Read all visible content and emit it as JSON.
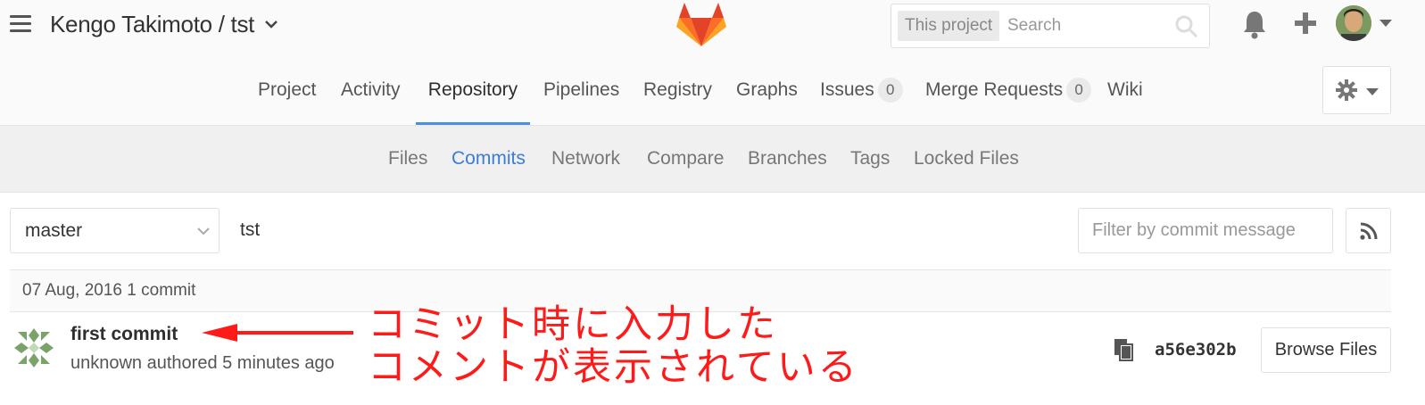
{
  "header": {
    "breadcrumb": "Kengo Takimoto / tst",
    "search_scope": "This project",
    "search_placeholder": "Search"
  },
  "nav": {
    "tabs": [
      {
        "label": "Project"
      },
      {
        "label": "Activity"
      },
      {
        "label": "Repository"
      },
      {
        "label": "Pipelines"
      },
      {
        "label": "Registry"
      },
      {
        "label": "Graphs"
      },
      {
        "label": "Issues",
        "count": "0"
      },
      {
        "label": "Merge Requests",
        "count": "0"
      },
      {
        "label": "Wiki"
      }
    ],
    "active": "Repository"
  },
  "subnav": {
    "tabs": [
      {
        "label": "Files"
      },
      {
        "label": "Commits"
      },
      {
        "label": "Network"
      },
      {
        "label": "Compare"
      },
      {
        "label": "Branches"
      },
      {
        "label": "Tags"
      },
      {
        "label": "Locked Files"
      }
    ],
    "active": "Commits"
  },
  "toolbar": {
    "branch": "master",
    "project_path": "tst",
    "filter_placeholder": "Filter by commit message"
  },
  "commits": {
    "day_header": "07 Aug, 2016 1 commit",
    "items": [
      {
        "title": "first commit",
        "meta": "unknown authored 5 minutes ago",
        "sha": "a56e302b",
        "browse_label": "Browse Files"
      }
    ]
  },
  "annotation": {
    "line1": "コミット時に入力した",
    "line2": "コメントが表示されている",
    "color": "#ff1a1a"
  },
  "colors": {
    "accent": "#4a90e2",
    "subnav_active": "#3a7dd8",
    "logo_orange": "#fc6d26",
    "logo_red": "#e24329",
    "logo_light": "#fca326"
  }
}
